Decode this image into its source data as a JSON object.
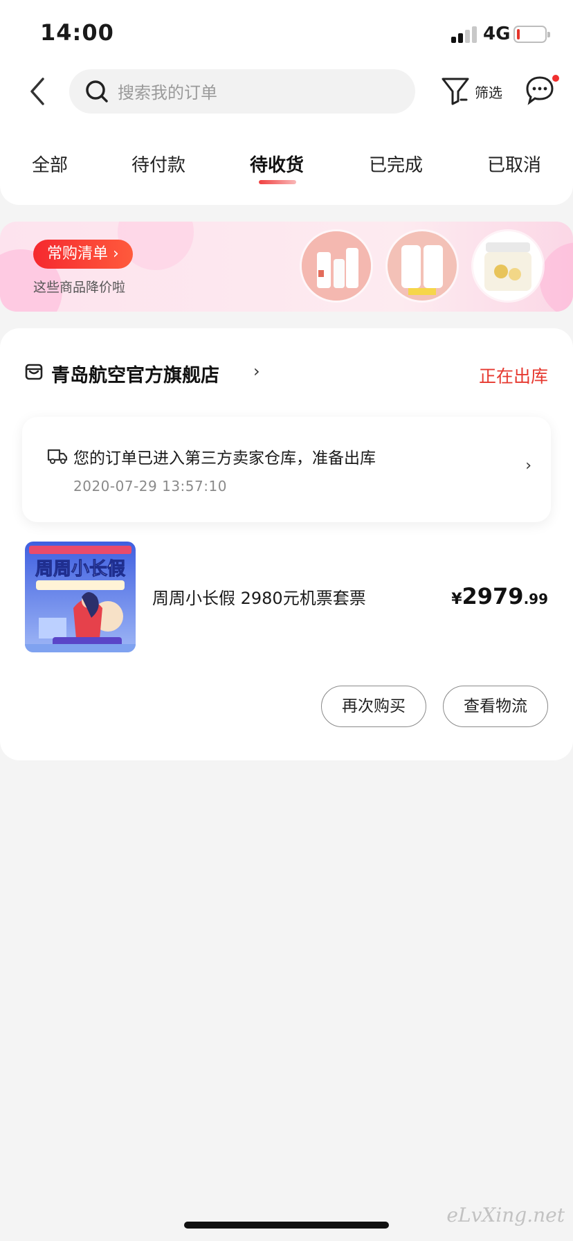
{
  "status_bar": {
    "time": "14:00",
    "network": "4G"
  },
  "header": {
    "search_placeholder": "搜索我的订单",
    "filter_label": "筛选"
  },
  "tabs": [
    {
      "label": "全部"
    },
    {
      "label": "待付款"
    },
    {
      "label": "待收货",
      "active": true
    },
    {
      "label": "已完成"
    },
    {
      "label": "已取消"
    }
  ],
  "banner": {
    "title": "常购清单 ›",
    "subtitle": "这些商品降价啦"
  },
  "order": {
    "store_name": "青岛航空官方旗舰店",
    "status": "正在出库",
    "logistics_text": "您的订单已进入第三方卖家仓库，准备出库",
    "logistics_time": "2020-07-29 13:57:10",
    "product_name": "周周小长假 2980元机票套票",
    "price_symbol": "¥",
    "price_int": "2979",
    "price_dec": ".99",
    "product_image_text": "周周小长假",
    "buttons": {
      "rebuy": "再次购买",
      "logistics": "查看物流"
    }
  },
  "watermark": "eLvXing.net",
  "colors": {
    "accent": "#e6382f",
    "banner_pill": "#f5292f",
    "bg": "#f4f4f4"
  }
}
